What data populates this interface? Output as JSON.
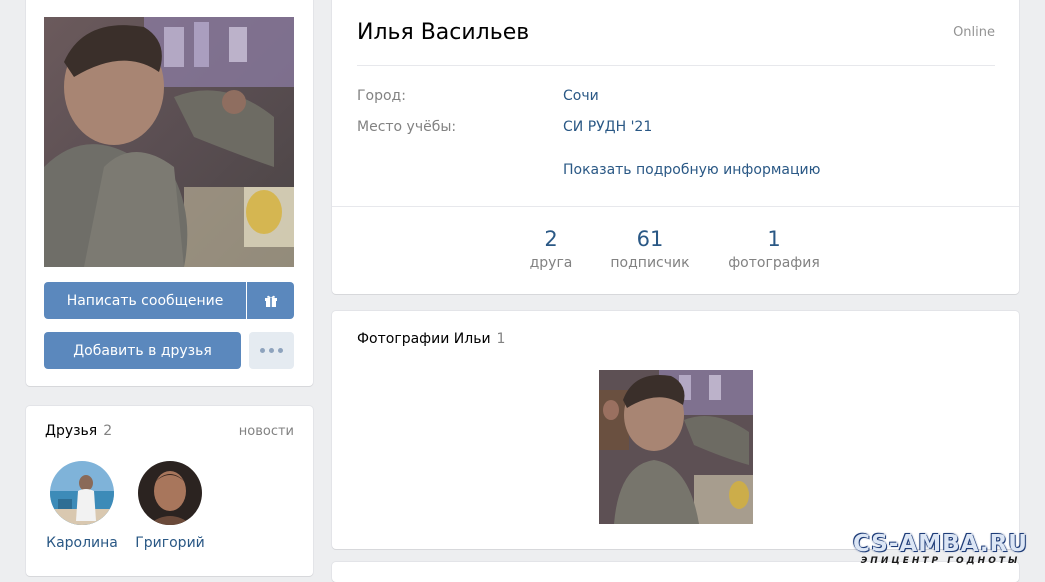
{
  "profile": {
    "name": "Илья Васильев",
    "status": "Online",
    "city_label": "Город:",
    "city_value": "Сочи",
    "education_label": "Место учёбы:",
    "education_value": "СИ РУДН '21",
    "show_details": "Показать подробную информацию"
  },
  "actions": {
    "send_message": "Написать сообщение",
    "add_friend": "Добавить в друзья",
    "gift_icon": "gift-icon",
    "more_icon": "more-dots-icon"
  },
  "counters": [
    {
      "value": "2",
      "label": "друга"
    },
    {
      "value": "61",
      "label": "подписчик"
    },
    {
      "value": "1",
      "label": "фотография"
    }
  ],
  "friends": {
    "title": "Друзья",
    "count": "2",
    "news_link": "новости",
    "items": [
      {
        "name": "Каролина"
      },
      {
        "name": "Григорий"
      }
    ]
  },
  "photos": {
    "title": "Фотографии Ильи",
    "count": "1"
  },
  "watermark": {
    "main": "CS-AMBA.RU",
    "sub": "ЭПИЦЕНТР ГОДНОТЫ"
  },
  "colors": {
    "link": "#2a5885",
    "button": "#5b88bd",
    "background": "#edeef0"
  }
}
